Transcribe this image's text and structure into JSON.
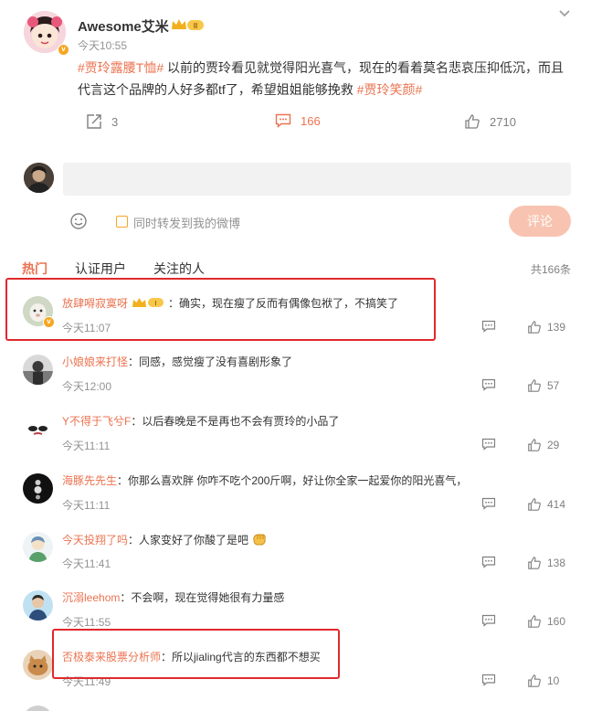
{
  "post": {
    "username": "Awesome艾米",
    "vip_label": "II",
    "time": "今天10:55",
    "text_topic1": "#贾玲露腰T恤#",
    "text_body": " 以前的贾玲看见就觉得阳光喜气，现在的看着莫名悲哀压抑低沉，而且代言这个品牌的人好多都tf了，希望姐姐能够挽救 ",
    "text_topic2": "#贾玲笑颜#",
    "repost_count": "3",
    "comment_count": "166",
    "like_count": "2710"
  },
  "composer": {
    "repost_label": "同时转发到我的微博",
    "submit_label": "评论"
  },
  "tabs": {
    "hot": "热门",
    "verified": "认证用户",
    "following": "关注的人",
    "total": "共166条"
  },
  "comments": [
    {
      "name": "放肆嘚寂寞呀",
      "text": "：确实，现在瘦了反而有偶像包袱了，不搞笑了",
      "time": "今天11:07",
      "likes": "139",
      "vip": "I"
    },
    {
      "name": "小娘娘来打怪",
      "text": "：同感，感觉瘦了没有喜剧形象了",
      "time": "今天12:00",
      "likes": "57"
    },
    {
      "name": "Y不得于飞兮F",
      "text": "：以后春晚是不是再也不会有贾玲的小品了",
      "time": "今天11:11",
      "likes": "29"
    },
    {
      "name": "海豚先先生",
      "text": "：你那么喜欢胖 你咋不吃个200斤啊，好让你全家一起爱你的阳光喜气，",
      "time": "今天11:11",
      "likes": "414"
    },
    {
      "name": "今天投翔了吗",
      "text": "：人家变好了你酸了是吧",
      "time": "今天11:41",
      "likes": "138"
    },
    {
      "name": "沉溺leehom",
      "text": "：不会啊，现在觉得她很有力量感",
      "time": "今天11:55",
      "likes": "160"
    },
    {
      "name": "否极泰来股票分析师",
      "text": "：所以jialing代言的东西都不想买",
      "time": "今天11:49",
      "likes": "10"
    }
  ]
}
